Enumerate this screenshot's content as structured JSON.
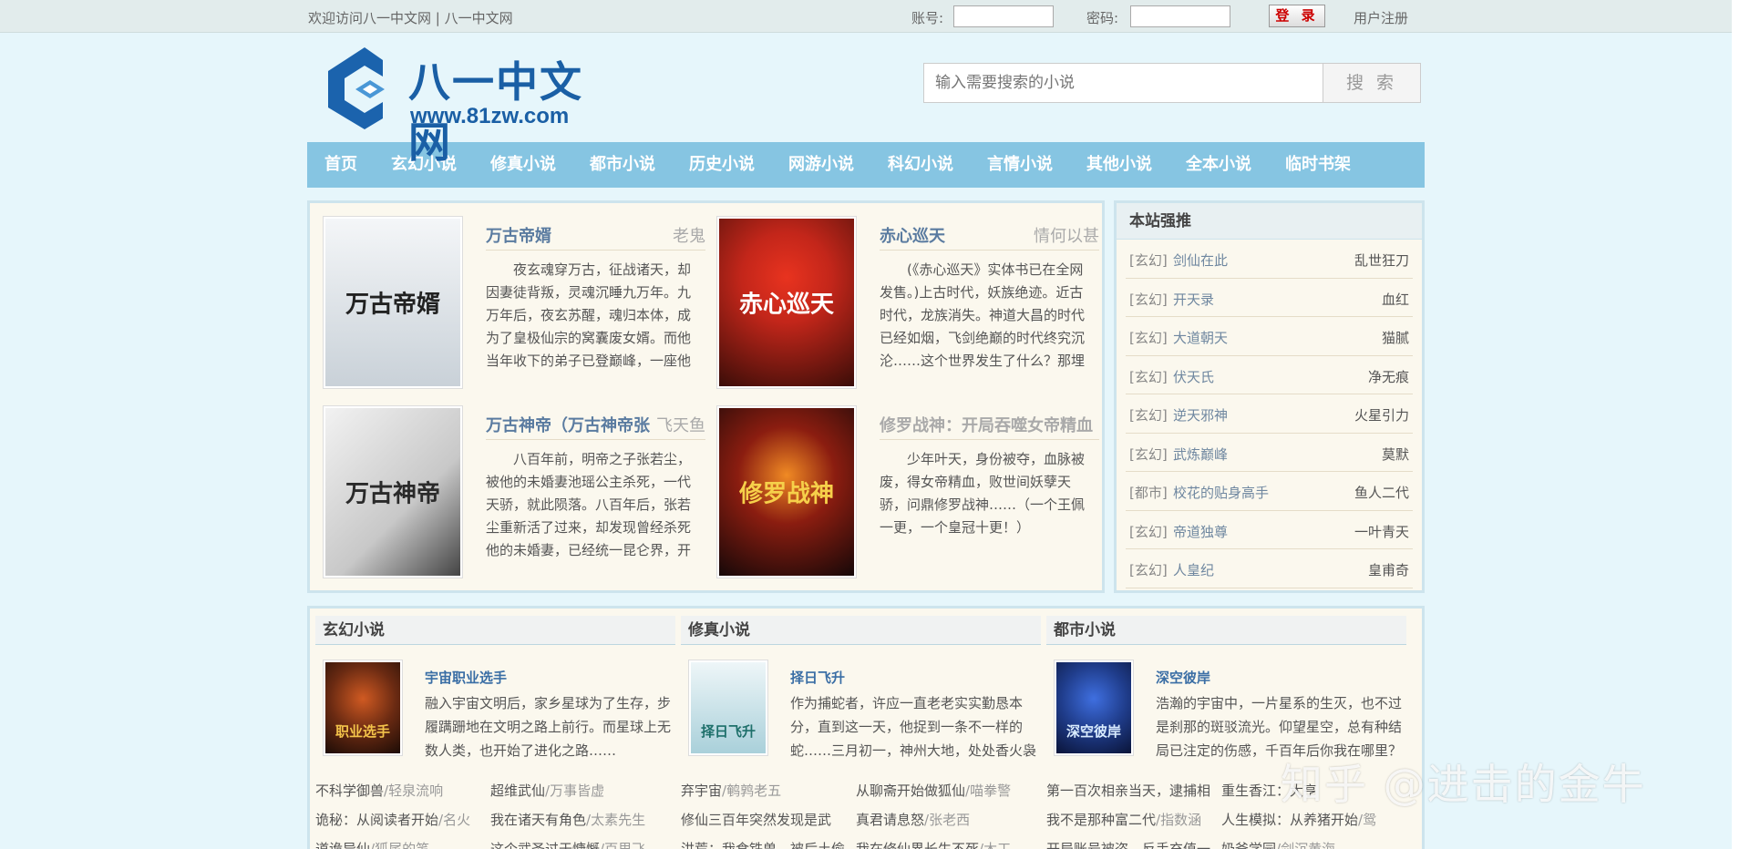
{
  "topbar": {
    "welcome": "欢迎访问八一中文网 | 八一中文网",
    "account_label": "账号:",
    "password_label": "密码:",
    "login_label": "登 录",
    "register_label": "用户注册"
  },
  "logo": {
    "name": "八一中文网",
    "url": "www.81zw.com"
  },
  "search": {
    "placeholder": "输入需要搜索的小说",
    "button": "搜 索"
  },
  "nav": [
    "首页",
    "玄幻小说",
    "修真小说",
    "都市小说",
    "历史小说",
    "网游小说",
    "科幻小说",
    "言情小说",
    "其他小说",
    "全本小说",
    "临时书架"
  ],
  "featured": [
    {
      "title": "万古帝婿",
      "author": "老鬼",
      "cover_text": "万古帝婿",
      "cover_color": "#e9eef2",
      "desc": "夜玄魂穿万古，征战诸天，却因妻徒背叛，灵魂沉睡九万年。九万年后，夜玄苏醒，魂归本体，成为了皇极仙宗的窝囊废女婿。而他当年收下的弟子已登巅峰，一座他曾修炼过"
    },
    {
      "title": "赤心巡天",
      "author": "情何以甚",
      "cover_text": "赤心巡天",
      "cover_color": "#b8261c",
      "desc": "(《赤心巡天》实体书已在全网发售。)上古时代，妖族绝迹。近古时代，龙族消失。神道大昌的时代已经如烟，飞剑绝巅的时代终究沉沦……这个世界发生了什么？那埋葬于时间长河里的历史真相，"
    },
    {
      "title": "万古神帝（万古神帝张若尘）",
      "author": "飞天鱼",
      "cover_text": "万古神帝",
      "cover_color": "#dedede",
      "desc": "八百年前，明帝之子张若尘，被他的未婚妻池瑶公主杀死，一代天骄，就此陨落。八百年后，张若尘重新活了过来，却发现曾经杀死他的未婚妻，已经统一昆仑界，开辟出第一中央帝国，号称“池瑶女"
    },
    {
      "title": "修罗战神：开局吞噬女帝精血",
      "author": "",
      "cover_text": "修罗战神",
      "cover_color": "#3a1818",
      "desc": "少年叶天，身份被夺，血脉被废，得女帝精血，败世间妖孽天骄，问鼎修罗战神……（一个王佩一更，一个皇冠十更！）"
    }
  ],
  "recommend": {
    "title": "本站强推",
    "items": [
      {
        "cat": "[玄幻]",
        "book": "剑仙在此",
        "author": "乱世狂刀"
      },
      {
        "cat": "[玄幻]",
        "book": "开天录",
        "author": "血红"
      },
      {
        "cat": "[玄幻]",
        "book": "大道朝天",
        "author": "猫腻"
      },
      {
        "cat": "[玄幻]",
        "book": "伏天氏",
        "author": "净无痕"
      },
      {
        "cat": "[玄幻]",
        "book": "逆天邪神",
        "author": "火星引力"
      },
      {
        "cat": "[玄幻]",
        "book": "武炼巅峰",
        "author": "莫默"
      },
      {
        "cat": "[都市]",
        "book": "校花的贴身高手",
        "author": "鱼人二代"
      },
      {
        "cat": "[玄幻]",
        "book": "帝道独尊",
        "author": "一叶青天"
      },
      {
        "cat": "[玄幻]",
        "book": "人皇纪",
        "author": "皇甫奇"
      }
    ]
  },
  "categories": [
    {
      "name": "玄幻小说",
      "book": "宇宙职业选手",
      "cover_text": "职业选手",
      "cover_color": "#6a2a12",
      "desc": "融入宇宙文明后，家乡星球为了生存，步履蹒跚地在文明之路上前行。而星球上无数人类，也开始了进化之路……",
      "links": [
        [
          {
            "t": "不科学御兽",
            "a": "/轻泉流响"
          },
          {
            "t": "超维武仙",
            "a": "/万事皆虚"
          }
        ],
        [
          {
            "t": "诡秘：从阅读者开始",
            "a": "/名火"
          },
          {
            "t": "我在诸天有角色",
            "a": "/太素先生"
          }
        ],
        [
          {
            "t": "道诡异仙",
            "a": "/狐尾的笔"
          },
          {
            "t": "这个武圣过于慷慨",
            "a": "/百里飞"
          }
        ]
      ]
    },
    {
      "name": "修真小说",
      "book": "择日飞升",
      "cover_text": "择日飞升",
      "cover_color": "#d8ebf0",
      "desc": "作为捕蛇者，许应一直老老实实勤恳本分，直到这一天，他捉到一条不一样的蛇……三月初一，神州大地，处处香火袅",
      "links": [
        [
          {
            "t": "弃宇宙",
            "a": "/鹌鹑老五"
          },
          {
            "t": "从聊斋开始做狐仙",
            "a": "/喵拳警"
          }
        ],
        [
          {
            "t": "修仙三百年突然发现是武",
            "a": ""
          },
          {
            "t": "真君请息怒",
            "a": "/张老西"
          }
        ],
        [
          {
            "t": "洪荒：我食铁兽，被后土偷",
            "a": ""
          },
          {
            "t": "我在修仙界长生不死",
            "a": "/木工"
          }
        ]
      ]
    },
    {
      "name": "都市小说",
      "book": "深空彼岸",
      "cover_text": "深空彼岸",
      "cover_color": "#1f3c8a",
      "desc": "浩瀚的宇宙中，一片星系的生灭，也不过是刹那的斑驳流光。仰望星空，总有种结局已注定的伤感，千百年后你我在哪里？",
      "links": [
        [
          {
            "t": "第一百次相亲当天，逮捕相",
            "a": ""
          },
          {
            "t": "重生香江：大亨",
            "a": ""
          }
        ],
        [
          {
            "t": "我不是那种富二代",
            "a": "/指数涵"
          },
          {
            "t": "人生模拟：从养猪开始",
            "a": "/鸳"
          }
        ],
        [
          {
            "t": "开局账号被盗，反手充值一",
            "a": ""
          },
          {
            "t": "奶爸学园",
            "a": "/剑沉黄海"
          }
        ]
      ]
    }
  ],
  "watermark": "知乎 @进击的金牛"
}
